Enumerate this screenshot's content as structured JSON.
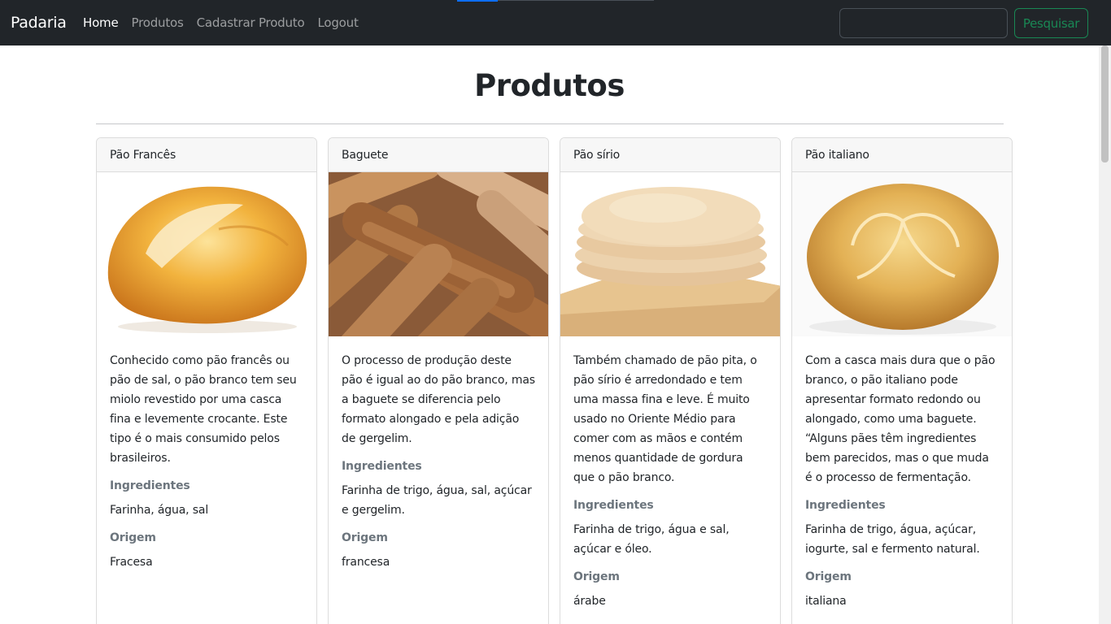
{
  "navbar": {
    "brand": "Padaria",
    "links": [
      {
        "label": "Home",
        "active": true
      },
      {
        "label": "Produtos",
        "active": false
      },
      {
        "label": "Cadastrar Produto",
        "active": false
      },
      {
        "label": "Logout",
        "active": false
      }
    ],
    "search": {
      "value": "",
      "placeholder": ""
    },
    "search_button": "Pesquisar"
  },
  "main": {
    "title": "Produtos",
    "ingredients_label": "Ingredientes",
    "origin_label": "Origem",
    "products": [
      {
        "name": "Pão Francês",
        "image": "french-bread-roll-image",
        "description": "Conhecido como pão francês ou pão de sal, o pão branco tem seu miolo revestido por uma casca fina e levemente crocante. Este tipo é o mais consumido pelos brasileiros.",
        "ingredients": "Farinha, água, sal",
        "origin": "Fracesa"
      },
      {
        "name": "Baguete",
        "image": "baguettes-image",
        "description": "O processo de produção deste pão é igual ao do pão branco, mas a baguete se diferencia pelo formato alongado e pela adição de gergelim.",
        "ingredients": "Farinha de trigo, água, sal, açúcar e gergelim.",
        "origin": "francesa"
      },
      {
        "name": "Pão sírio",
        "image": "pita-bread-stack-image",
        "description": "Também chamado de pão pita, o pão sírio é arredondado e tem uma massa fina e leve. É muito usado no Oriente Médio para comer com as mãos e contém menos quantidade de gordura que o pão branco.",
        "ingredients": "Farinha de trigo, água e sal, açúcar e óleo.",
        "origin": "árabe"
      },
      {
        "name": "Pão italiano",
        "image": "italian-bread-image",
        "description": "Com a casca mais dura que o pão branco, o pão italiano pode apresentar formato redondo ou alongado, como uma baguete. “Alguns pães têm ingredientes bem parecidos, mas o que muda é o processo de fermentação.",
        "ingredients": "Farinha de trigo, água, açúcar, iogurte, sal e fermento natural.",
        "origin": "italiana"
      }
    ]
  }
}
